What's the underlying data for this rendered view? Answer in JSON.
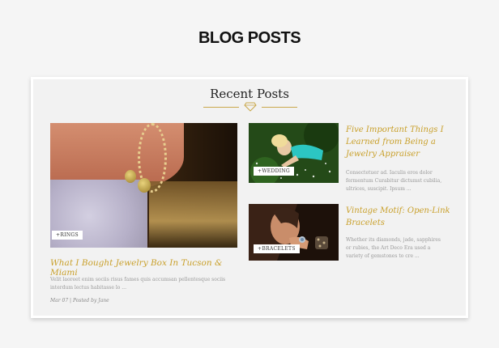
{
  "page": {
    "heading": "BLOG POSTS"
  },
  "section": {
    "title": "Recent Posts"
  },
  "featured": {
    "category": "+RINGS",
    "title": "What I Bought Jewelry Box In Tucson & Miami",
    "excerpt": "Velit laoreet enim sociis risus fames quis accumsan pellentesque sociis interdum lectus habitasse lo ...",
    "meta": "Mar 07 | Posted by Jane"
  },
  "posts": [
    {
      "category": "+WEDDING",
      "title": "Five Important Things I Learned from Being a Jewelry Appraiser",
      "excerpt": "Consectetuer ad. Iaculis eros dolor fermentum Curabitur dictumst cubilia, ultrices, suscipit. Ipsum ..."
    },
    {
      "category": "+BRACELETS",
      "title": "Vintage Motif: Open-Link Bracelets",
      "excerpt": "Whether its diamonds, jade, sapphires or rubies, the Art Deco Era used a variety of gemstones to cre ..."
    }
  ],
  "colors": {
    "accent": "#c9a02b",
    "background": "#f5f5f5",
    "card": "#f2f2f2"
  },
  "icons": {
    "divider": "diamond-icon"
  }
}
